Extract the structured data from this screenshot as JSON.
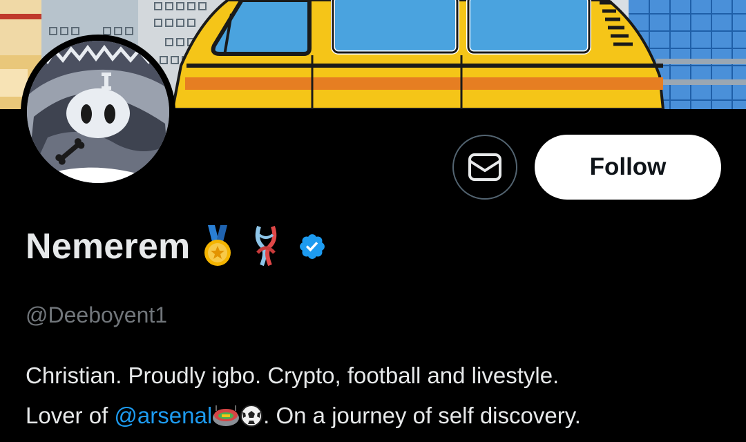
{
  "profile": {
    "display_name": "Nemerem",
    "badges": [
      "medal-emoji",
      "ribbon-emoji"
    ],
    "verified": true,
    "handle": "@Deeboyent1",
    "bio_line1": "Christian. Proudly igbo. Crypto, football and livestyle.",
    "bio_line2_prefix": "Lover of ",
    "bio_mention": "@arsenal",
    "bio_line2_suffix": ".  On a journey of self discovery.",
    "bio_emojis": [
      "stadium-emoji",
      "soccer-ball-emoji"
    ]
  },
  "actions": {
    "follow_label": "Follow",
    "message_icon": "envelope-icon"
  },
  "colors": {
    "background": "#000000",
    "accent_blue": "#1d9bf0",
    "muted_text": "#71767b",
    "banner_bus_yellow": "#f5c518"
  }
}
